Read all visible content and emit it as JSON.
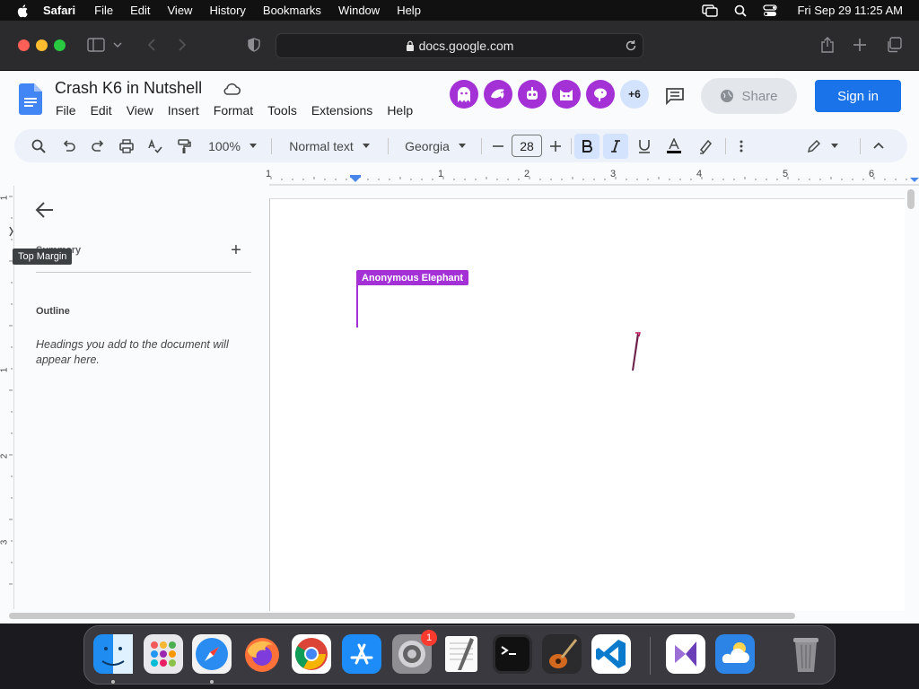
{
  "menubar": {
    "app": "Safari",
    "items": [
      "File",
      "Edit",
      "View",
      "History",
      "Bookmarks",
      "Window",
      "Help"
    ],
    "clock": "Fri Sep 29  11:25 AM"
  },
  "safari": {
    "url": "docs.google.com"
  },
  "docs": {
    "title": "Crash K6 in Nutshell",
    "menus": [
      "File",
      "Edit",
      "View",
      "Insert",
      "Format",
      "Tools",
      "Extensions",
      "Help"
    ],
    "more_collaborators": "+6",
    "share_label": "Share",
    "signin_label": "Sign in",
    "accent_color": "#a331d6",
    "signin_color": "#1a73e8"
  },
  "toolbar": {
    "zoom": "100%",
    "style": "Normal text",
    "font": "Georgia",
    "font_size": "28"
  },
  "ruler": {
    "numbers": [
      "1",
      "1",
      "2",
      "3",
      "4",
      "5",
      "6"
    ],
    "vnumbers": [
      "1",
      "1",
      "2",
      "3"
    ]
  },
  "outline": {
    "summary": "Summary",
    "outline_label": "Outline",
    "hint": "Headings you add to the document will appear here.",
    "tooltip": "Top Margin"
  },
  "document": {
    "collaborator_name": "Anonymous Elephant"
  },
  "dock": {
    "apps": [
      "Finder",
      "Launchpad",
      "Safari",
      "Firefox",
      "Chrome",
      "App Store",
      "System Settings",
      "TextEdit",
      "Terminal",
      "GarageBand",
      "Visual Studio Code",
      "Visual Studio",
      "Weather",
      "Trash"
    ],
    "settings_badge": "1"
  }
}
